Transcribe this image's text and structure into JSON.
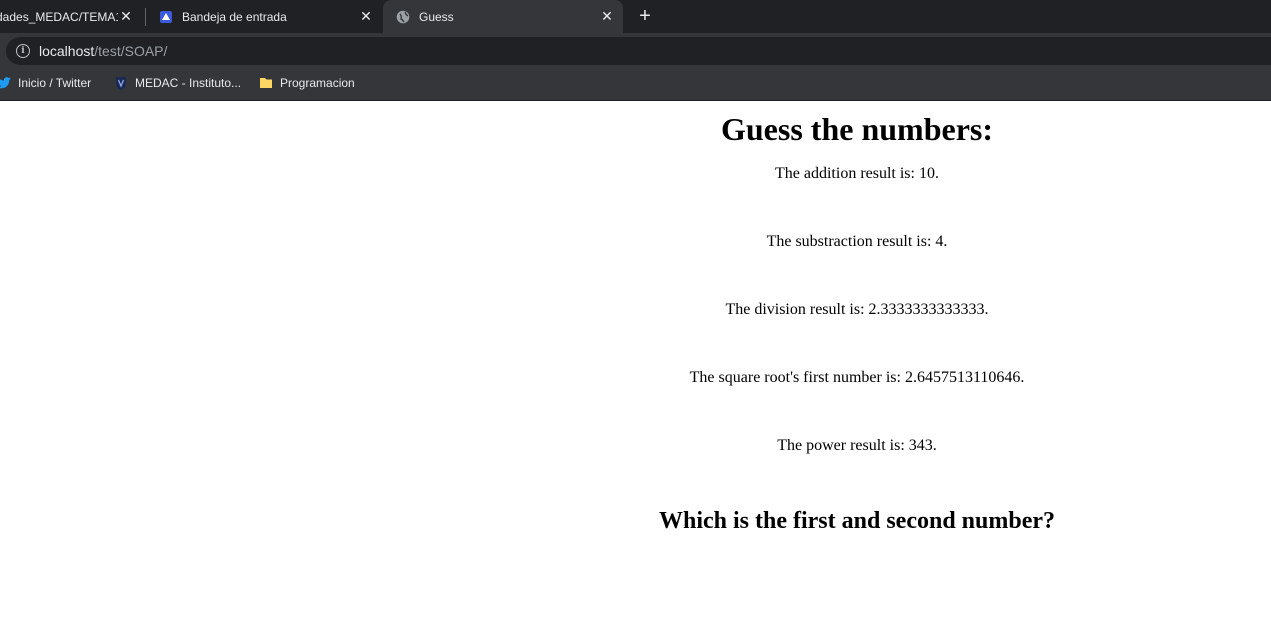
{
  "browser": {
    "tabs": [
      {
        "title": "dades_MEDAC/TEMA1",
        "icon": "none"
      },
      {
        "title": "Bandeja de entrada",
        "icon": "blue-logo-icon"
      },
      {
        "title": "Guess",
        "icon": "globe-icon",
        "active": true
      }
    ],
    "new_tab_label": "+",
    "close_label": "✕",
    "address": {
      "host": "localhost",
      "path": "/test/SOAP/"
    },
    "bookmarks": [
      {
        "label": "Inicio / Twitter",
        "icon": "twitter-icon"
      },
      {
        "label": "MEDAC - Instituto...",
        "icon": "shield-icon"
      },
      {
        "label": "Programacion",
        "icon": "folder-icon"
      }
    ]
  },
  "page": {
    "heading": "Guess the numbers:",
    "results": [
      "The addition result is: 10.",
      "The substraction result is: 4.",
      "The division result is: 2.3333333333333.",
      "The square root's first number is: 2.6457513110646.",
      "The power result is: 343."
    ],
    "question": "Which is the first and second number?"
  },
  "colors": {
    "chrome_dark": "#202124",
    "chrome_light": "#35363a",
    "text_light": "#e8eaed"
  }
}
